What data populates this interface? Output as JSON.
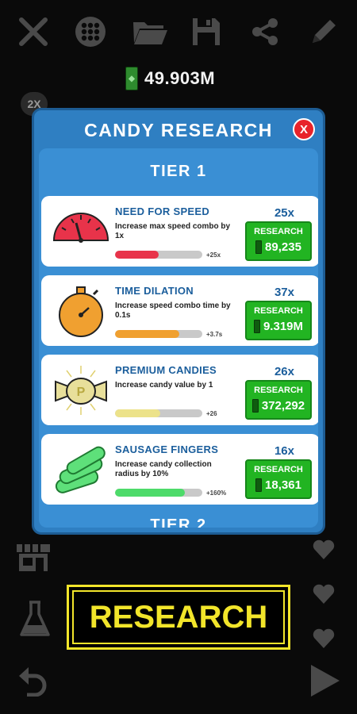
{
  "toolbar": {
    "icons": [
      "close-icon",
      "grid-icon",
      "folder-icon",
      "save-icon",
      "share-icon",
      "pencil-icon"
    ]
  },
  "money": "49.903M",
  "multiplier_badge": "2X",
  "panel": {
    "title": "CANDY RESEARCH",
    "close_label": "X",
    "tier1": "TIER 1",
    "tier2": "TIER 2",
    "research_label": "RESEARCH",
    "items": [
      {
        "name": "NEED FOR SPEED",
        "desc": "Increase max speed combo by 1x",
        "count": "25x",
        "increment": "+25x",
        "cost": "89,235",
        "progress": 0.5,
        "bar_color": "#e8334a"
      },
      {
        "name": "TIME DILATION",
        "desc": "Increase speed combo time by 0.1s",
        "count": "37x",
        "increment": "+3.7s",
        "cost": "9.319M",
        "progress": 0.74,
        "bar_color": "#f0a030"
      },
      {
        "name": "PREMIUM CANDIES",
        "desc": "Increase candy value by 1",
        "count": "26x",
        "increment": "+26",
        "cost": "372,292",
        "progress": 0.52,
        "bar_color": "#ece28a"
      },
      {
        "name": "SAUSAGE FINGERS",
        "desc": "Increase candy collection radius by 10%",
        "count": "16x",
        "increment": "+160%",
        "cost": "18,361",
        "progress": 0.8,
        "bar_color": "#4ddb6a"
      }
    ]
  },
  "screen_title": "RESEARCH",
  "side_icons": [
    "shop-icon",
    "flask-icon",
    "undo-icon"
  ],
  "right_icons": [
    "heart-icon",
    "heart-icon",
    "heart-icon",
    "play-icon"
  ],
  "colors": {
    "accent": "#2f7fc2",
    "button_green": "#22b422",
    "title_yellow": "#f2e52a"
  }
}
